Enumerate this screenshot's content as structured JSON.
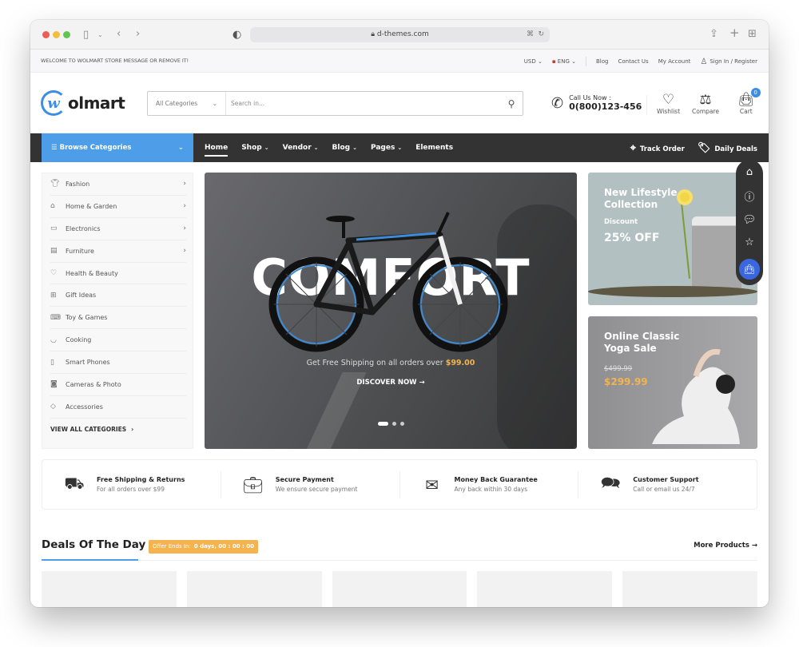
{
  "browser": {
    "url": "d-themes.com",
    "icons": [
      "sidebar-icon",
      "back-icon",
      "forward-icon",
      "shield-icon",
      "lock-icon",
      "translate-icon",
      "reload-icon",
      "share-icon",
      "new-tab-icon",
      "tabs-overview-icon"
    ]
  },
  "topbar": {
    "welcome": "WELCOME TO WOLMART STORE MESSAGE OR REMOVE IT!",
    "currency": "USD",
    "language": "ENG",
    "links": [
      "Blog",
      "Contact Us",
      "My Account"
    ],
    "signin": "Sign In",
    "register": "Register",
    "slash": "/"
  },
  "header": {
    "logo_mark": "w",
    "logo_text": "olmart",
    "search": {
      "category": "All Categories",
      "placeholder": "Search in..."
    },
    "call_label": "Call Us Now :",
    "phone": "0(800)123-456",
    "wishlist": "Wishlist",
    "compare": "Compare",
    "cart": "Cart",
    "cart_count": "0"
  },
  "nav": {
    "browse": "Browse Categories",
    "items": [
      {
        "label": "Home",
        "dropdown": false
      },
      {
        "label": "Shop",
        "dropdown": true
      },
      {
        "label": "Vendor",
        "dropdown": true
      },
      {
        "label": "Blog",
        "dropdown": true
      },
      {
        "label": "Pages",
        "dropdown": true
      },
      {
        "label": "Elements",
        "dropdown": false
      }
    ],
    "track_order": "Track Order",
    "daily_deals": "Daily Deals"
  },
  "sidebar": {
    "items": [
      {
        "label": "Fashion",
        "icon": "tshirt-icon",
        "submenu": true
      },
      {
        "label": "Home & Garden",
        "icon": "home-icon",
        "submenu": true
      },
      {
        "label": "Electronics",
        "icon": "monitor-icon",
        "submenu": true
      },
      {
        "label": "Furniture",
        "icon": "bed-icon",
        "submenu": true
      },
      {
        "label": "Health & Beauty",
        "icon": "heart-pulse-icon",
        "submenu": false
      },
      {
        "label": "Gift Ideas",
        "icon": "gift-icon",
        "submenu": false
      },
      {
        "label": "Toy & Games",
        "icon": "gamepad-icon",
        "submenu": false
      },
      {
        "label": "Cooking",
        "icon": "cooking-icon",
        "submenu": false
      },
      {
        "label": "Smart Phones",
        "icon": "phone-icon",
        "submenu": false
      },
      {
        "label": "Cameras & Photo",
        "icon": "camera-icon",
        "submenu": false
      },
      {
        "label": "Accessories",
        "icon": "diamond-icon",
        "submenu": false
      }
    ],
    "view_all": "VIEW ALL CATEGORIES"
  },
  "hero": {
    "headline": "COMFORT",
    "shipping_text": "Get Free Shipping on all orders over",
    "shipping_price": "$99.00",
    "cta": "DISCOVER NOW",
    "slides": 3,
    "active_slide": 1
  },
  "banners": [
    {
      "title_1": "New Lifestyle",
      "title_2": "Collection",
      "subtitle": "Discount",
      "offer": "25% OFF"
    },
    {
      "title_1": "Online Classic",
      "title_2": "Yoga Sale",
      "old_price": "$499.99",
      "new_price": "$299.99"
    }
  ],
  "floating_bar": [
    "home-icon",
    "info-icon",
    "chat-icon",
    "star-icon",
    "shopping-bag-icon"
  ],
  "features": [
    {
      "title": "Free Shipping & Returns",
      "subtitle": "For all orders over $99",
      "icon": "truck-icon"
    },
    {
      "title": "Secure Payment",
      "subtitle": "We ensure secure payment",
      "icon": "briefcase-icon"
    },
    {
      "title": "Money Back Guarantee",
      "subtitle": "Any back within 30 days",
      "icon": "money-envelope-icon"
    },
    {
      "title": "Customer Support",
      "subtitle": "Call or email us 24/7",
      "icon": "chat-bubbles-icon"
    }
  ],
  "deals": {
    "title": "Deals Of The Day",
    "offer_label": "Offer Ends In:",
    "offer_time": "0 days, 00 : 00 : 00",
    "more": "More Products",
    "product_count": 5
  },
  "colors": {
    "accent": "#4d9de9",
    "nav_bg": "#333333",
    "highlight": "#f4b34e",
    "cart_button": "#3a66e0"
  }
}
